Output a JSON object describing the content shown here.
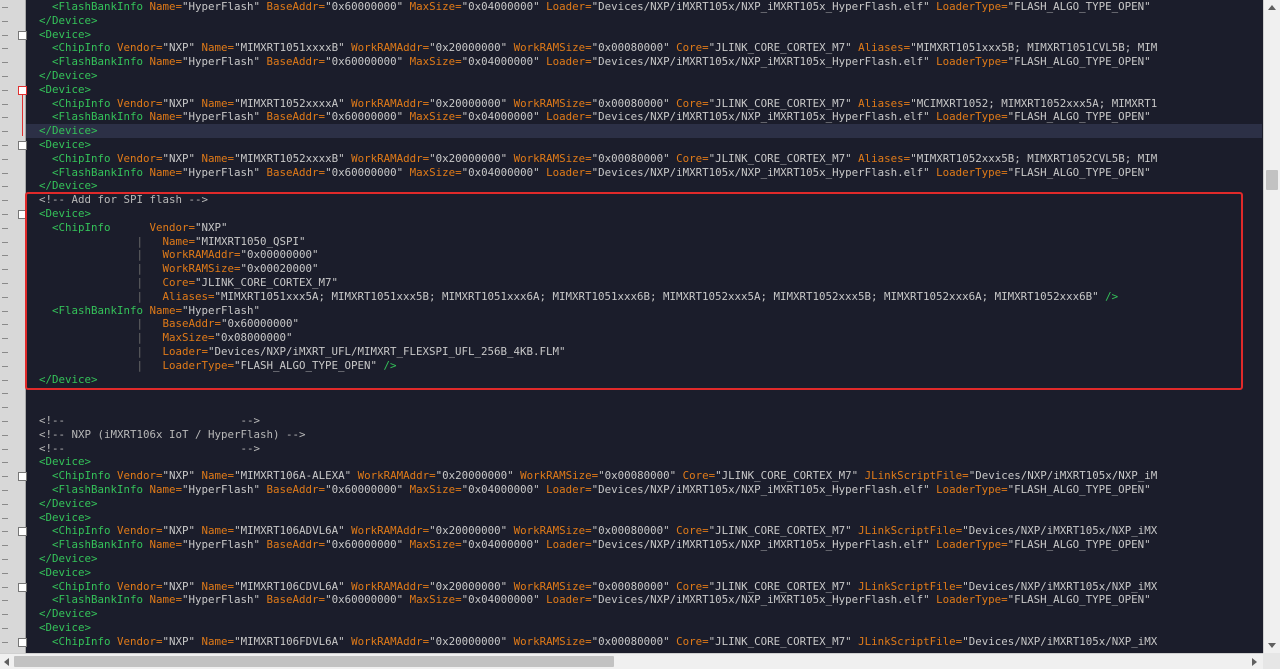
{
  "editor": {
    "lines": [
      [
        [
          "gd",
          ""
        ],
        [
          "tg",
          "    <FlashBankInfo "
        ],
        [
          "at",
          "Name="
        ],
        [
          "vl",
          "\"HyperFlash\" "
        ],
        [
          "at",
          "BaseAddr="
        ],
        [
          "vl",
          "\"0x60000000\" "
        ],
        [
          "at",
          "MaxSize="
        ],
        [
          "vl",
          "\"0x04000000\" "
        ],
        [
          "at",
          "Loader="
        ],
        [
          "vl",
          "\"Devices/NXP/iMXRT105x/NXP_iMXRT105x_HyperFlash.elf\" "
        ],
        [
          "at",
          "LoaderType="
        ],
        [
          "vl",
          "\"FLASH_ALGO_TYPE_OPEN\""
        ]
      ],
      [
        [
          "tg",
          "  </Device>"
        ]
      ],
      [
        [
          "tg",
          "  <Device>"
        ]
      ],
      [
        [
          "tg",
          "    <ChipInfo "
        ],
        [
          "at",
          "Vendor="
        ],
        [
          "vl",
          "\"NXP\" "
        ],
        [
          "at",
          "Name="
        ],
        [
          "vl",
          "\"MIMXRT1051xxxxB\" "
        ],
        [
          "at",
          "WorkRAMAddr="
        ],
        [
          "vl",
          "\"0x20000000\" "
        ],
        [
          "at",
          "WorkRAMSize="
        ],
        [
          "vl",
          "\"0x00080000\" "
        ],
        [
          "at",
          "Core="
        ],
        [
          "vl",
          "\"JLINK_CORE_CORTEX_M7\" "
        ],
        [
          "at",
          "Aliases="
        ],
        [
          "vl",
          "\"MIMXRT1051xxx5B; MIMXRT1051CVL5B; MIM"
        ]
      ],
      [
        [
          "tg",
          "    <FlashBankInfo "
        ],
        [
          "at",
          "Name="
        ],
        [
          "vl",
          "\"HyperFlash\" "
        ],
        [
          "at",
          "BaseAddr="
        ],
        [
          "vl",
          "\"0x60000000\" "
        ],
        [
          "at",
          "MaxSize="
        ],
        [
          "vl",
          "\"0x04000000\" "
        ],
        [
          "at",
          "Loader="
        ],
        [
          "vl",
          "\"Devices/NXP/iMXRT105x/NXP_iMXRT105x_HyperFlash.elf\" "
        ],
        [
          "at",
          "LoaderType="
        ],
        [
          "vl",
          "\"FLASH_ALGO_TYPE_OPEN\""
        ]
      ],
      [
        [
          "tg",
          "  </Device>"
        ]
      ],
      [
        [
          "tg",
          "  <Device>"
        ]
      ],
      [
        [
          "tg",
          "    <ChipInfo "
        ],
        [
          "at",
          "Vendor="
        ],
        [
          "vl",
          "\"NXP\" "
        ],
        [
          "at",
          "Name="
        ],
        [
          "vl",
          "\"MIMXRT1052xxxxA\" "
        ],
        [
          "at",
          "WorkRAMAddr="
        ],
        [
          "vl",
          "\"0x20000000\" "
        ],
        [
          "at",
          "WorkRAMSize="
        ],
        [
          "vl",
          "\"0x00080000\" "
        ],
        [
          "at",
          "Core="
        ],
        [
          "vl",
          "\"JLINK_CORE_CORTEX_M7\" "
        ],
        [
          "at",
          "Aliases="
        ],
        [
          "vl",
          "\"MCIMXRT1052; MIMXRT1052xxx5A; MIMXRT1"
        ]
      ],
      [
        [
          "tg",
          "    <FlashBankInfo "
        ],
        [
          "at",
          "Name="
        ],
        [
          "vl",
          "\"HyperFlash\" "
        ],
        [
          "at",
          "BaseAddr="
        ],
        [
          "vl",
          "\"0x60000000\" "
        ],
        [
          "at",
          "MaxSize="
        ],
        [
          "vl",
          "\"0x04000000\" "
        ],
        [
          "at",
          "Loader="
        ],
        [
          "vl",
          "\"Devices/NXP/iMXRT105x/NXP_iMXRT105x_HyperFlash.elf\" "
        ],
        [
          "at",
          "LoaderType="
        ],
        [
          "vl",
          "\"FLASH_ALGO_TYPE_OPEN\""
        ]
      ],
      [
        [
          "tg",
          "  </Device>"
        ]
      ],
      [
        [
          "tg",
          "  <Device>"
        ]
      ],
      [
        [
          "tg",
          "    <ChipInfo "
        ],
        [
          "at",
          "Vendor="
        ],
        [
          "vl",
          "\"NXP\" "
        ],
        [
          "at",
          "Name="
        ],
        [
          "vl",
          "\"MIMXRT1052xxxxB\" "
        ],
        [
          "at",
          "WorkRAMAddr="
        ],
        [
          "vl",
          "\"0x20000000\" "
        ],
        [
          "at",
          "WorkRAMSize="
        ],
        [
          "vl",
          "\"0x00080000\" "
        ],
        [
          "at",
          "Core="
        ],
        [
          "vl",
          "\"JLINK_CORE_CORTEX_M7\" "
        ],
        [
          "at",
          "Aliases="
        ],
        [
          "vl",
          "\"MIMXRT1052xxx5B; MIMXRT1052CVL5B; MIM"
        ]
      ],
      [
        [
          "tg",
          "    <FlashBankInfo "
        ],
        [
          "at",
          "Name="
        ],
        [
          "vl",
          "\"HyperFlash\" "
        ],
        [
          "at",
          "BaseAddr="
        ],
        [
          "vl",
          "\"0x60000000\" "
        ],
        [
          "at",
          "MaxSize="
        ],
        [
          "vl",
          "\"0x04000000\" "
        ],
        [
          "at",
          "Loader="
        ],
        [
          "vl",
          "\"Devices/NXP/iMXRT105x/NXP_iMXRT105x_HyperFlash.elf\" "
        ],
        [
          "at",
          "LoaderType="
        ],
        [
          "vl",
          "\"FLASH_ALGO_TYPE_OPEN\""
        ]
      ],
      [
        [
          "tg",
          "  </Device>"
        ]
      ],
      [
        [
          "cm",
          "  <!-- Add for SPI flash -->"
        ]
      ],
      [
        [
          "tg",
          "  <Device>"
        ]
      ],
      [
        [
          "tg",
          "    <ChipInfo      "
        ],
        [
          "at",
          "Vendor="
        ],
        [
          "vl",
          "\"NXP\""
        ]
      ],
      [
        [
          "gd",
          "                 |   "
        ],
        [
          "at",
          "Name="
        ],
        [
          "vl",
          "\"MIMXRT1050_QSPI\""
        ]
      ],
      [
        [
          "gd",
          "                 |   "
        ],
        [
          "at",
          "WorkRAMAddr="
        ],
        [
          "vl",
          "\"0x00000000\""
        ]
      ],
      [
        [
          "gd",
          "                 |   "
        ],
        [
          "at",
          "WorkRAMSize="
        ],
        [
          "vl",
          "\"0x00020000\""
        ]
      ],
      [
        [
          "gd",
          "                 |   "
        ],
        [
          "at",
          "Core="
        ],
        [
          "vl",
          "\"JLINK_CORE_CORTEX_M7\""
        ]
      ],
      [
        [
          "gd",
          "                 |   "
        ],
        [
          "at",
          "Aliases="
        ],
        [
          "vl",
          "\"MIMXRT1051xxx5A; MIMXRT1051xxx5B; MIMXRT1051xxx6A; MIMXRT1051xxx6B; MIMXRT1052xxx5A; MIMXRT1052xxx5B; MIMXRT1052xxx6A; MIMXRT1052xxx6B\" "
        ],
        [
          "tg",
          "/>"
        ]
      ],
      [
        [
          "tg",
          "    <FlashBankInfo "
        ],
        [
          "at",
          "Name="
        ],
        [
          "vl",
          "\"HyperFlash\""
        ]
      ],
      [
        [
          "gd",
          "                 |   "
        ],
        [
          "at",
          "BaseAddr="
        ],
        [
          "vl",
          "\"0x60000000\""
        ]
      ],
      [
        [
          "gd",
          "                 |   "
        ],
        [
          "at",
          "MaxSize="
        ],
        [
          "vl",
          "\"0x08000000\""
        ]
      ],
      [
        [
          "gd",
          "                 |   "
        ],
        [
          "at",
          "Loader="
        ],
        [
          "vl",
          "\"Devices/NXP/iMXRT_UFL/MIMXRT_FLEXSPI_UFL_256B_4KB.FLM\""
        ]
      ],
      [
        [
          "gd",
          "                 |   "
        ],
        [
          "at",
          "LoaderType="
        ],
        [
          "vl",
          "\"FLASH_ALGO_TYPE_OPEN\" "
        ],
        [
          "tg",
          "/>"
        ]
      ],
      [
        [
          "tg",
          "  </Device>"
        ]
      ],
      [
        [
          "vl",
          ""
        ]
      ],
      [
        [
          "vl",
          ""
        ]
      ],
      [
        [
          "cm",
          "  <!--                           -->"
        ]
      ],
      [
        [
          "cm",
          "  <!-- NXP (iMXRT106x IoT / HyperFlash) -->"
        ]
      ],
      [
        [
          "cm",
          "  <!--                           -->"
        ]
      ],
      [
        [
          "tg",
          "  <Device>"
        ]
      ],
      [
        [
          "tg",
          "    <ChipInfo "
        ],
        [
          "at",
          "Vendor="
        ],
        [
          "vl",
          "\"NXP\" "
        ],
        [
          "at",
          "Name="
        ],
        [
          "vl",
          "\"MIMXRT106A-ALEXA\" "
        ],
        [
          "at",
          "WorkRAMAddr="
        ],
        [
          "vl",
          "\"0x20000000\" "
        ],
        [
          "at",
          "WorkRAMSize="
        ],
        [
          "vl",
          "\"0x00080000\" "
        ],
        [
          "at",
          "Core="
        ],
        [
          "vl",
          "\"JLINK_CORE_CORTEX_M7\" "
        ],
        [
          "at",
          "JLinkScriptFile="
        ],
        [
          "vl",
          "\"Devices/NXP/iMXRT105x/NXP_iM"
        ]
      ],
      [
        [
          "tg",
          "    <FlashBankInfo "
        ],
        [
          "at",
          "Name="
        ],
        [
          "vl",
          "\"HyperFlash\" "
        ],
        [
          "at",
          "BaseAddr="
        ],
        [
          "vl",
          "\"0x60000000\" "
        ],
        [
          "at",
          "MaxSize="
        ],
        [
          "vl",
          "\"0x04000000\" "
        ],
        [
          "at",
          "Loader="
        ],
        [
          "vl",
          "\"Devices/NXP/iMXRT105x/NXP_iMXRT105x_HyperFlash.elf\" "
        ],
        [
          "at",
          "LoaderType="
        ],
        [
          "vl",
          "\"FLASH_ALGO_TYPE_OPEN\""
        ]
      ],
      [
        [
          "tg",
          "  </Device>"
        ]
      ],
      [
        [
          "tg",
          "  <Device>"
        ]
      ],
      [
        [
          "tg",
          "    <ChipInfo "
        ],
        [
          "at",
          "Vendor="
        ],
        [
          "vl",
          "\"NXP\" "
        ],
        [
          "at",
          "Name="
        ],
        [
          "vl",
          "\"MIMXRT106ADVL6A\" "
        ],
        [
          "at",
          "WorkRAMAddr="
        ],
        [
          "vl",
          "\"0x20000000\" "
        ],
        [
          "at",
          "WorkRAMSize="
        ],
        [
          "vl",
          "\"0x00080000\" "
        ],
        [
          "at",
          "Core="
        ],
        [
          "vl",
          "\"JLINK_CORE_CORTEX_M7\" "
        ],
        [
          "at",
          "JLinkScriptFile="
        ],
        [
          "vl",
          "\"Devices/NXP/iMXRT105x/NXP_iMX"
        ]
      ],
      [
        [
          "tg",
          "    <FlashBankInfo "
        ],
        [
          "at",
          "Name="
        ],
        [
          "vl",
          "\"HyperFlash\" "
        ],
        [
          "at",
          "BaseAddr="
        ],
        [
          "vl",
          "\"0x60000000\" "
        ],
        [
          "at",
          "MaxSize="
        ],
        [
          "vl",
          "\"0x04000000\" "
        ],
        [
          "at",
          "Loader="
        ],
        [
          "vl",
          "\"Devices/NXP/iMXRT105x/NXP_iMXRT105x_HyperFlash.elf\" "
        ],
        [
          "at",
          "LoaderType="
        ],
        [
          "vl",
          "\"FLASH_ALGO_TYPE_OPEN\""
        ]
      ],
      [
        [
          "tg",
          "  </Device>"
        ]
      ],
      [
        [
          "tg",
          "  <Device>"
        ]
      ],
      [
        [
          "tg",
          "    <ChipInfo "
        ],
        [
          "at",
          "Vendor="
        ],
        [
          "vl",
          "\"NXP\" "
        ],
        [
          "at",
          "Name="
        ],
        [
          "vl",
          "\"MIMXRT106CDVL6A\" "
        ],
        [
          "at",
          "WorkRAMAddr="
        ],
        [
          "vl",
          "\"0x20000000\" "
        ],
        [
          "at",
          "WorkRAMSize="
        ],
        [
          "vl",
          "\"0x00080000\" "
        ],
        [
          "at",
          "Core="
        ],
        [
          "vl",
          "\"JLINK_CORE_CORTEX_M7\" "
        ],
        [
          "at",
          "JLinkScriptFile="
        ],
        [
          "vl",
          "\"Devices/NXP/iMXRT105x/NXP_iMX"
        ]
      ],
      [
        [
          "tg",
          "    <FlashBankInfo "
        ],
        [
          "at",
          "Name="
        ],
        [
          "vl",
          "\"HyperFlash\" "
        ],
        [
          "at",
          "BaseAddr="
        ],
        [
          "vl",
          "\"0x60000000\" "
        ],
        [
          "at",
          "MaxSize="
        ],
        [
          "vl",
          "\"0x04000000\" "
        ],
        [
          "at",
          "Loader="
        ],
        [
          "vl",
          "\"Devices/NXP/iMXRT105x/NXP_iMXRT105x_HyperFlash.elf\" "
        ],
        [
          "at",
          "LoaderType="
        ],
        [
          "vl",
          "\"FLASH_ALGO_TYPE_OPEN\""
        ]
      ],
      [
        [
          "tg",
          "  </Device>"
        ]
      ],
      [
        [
          "tg",
          "  <Device>"
        ]
      ],
      [
        [
          "tg",
          "    <ChipInfo "
        ],
        [
          "at",
          "Vendor="
        ],
        [
          "vl",
          "\"NXP\" "
        ],
        [
          "at",
          "Name="
        ],
        [
          "vl",
          "\"MIMXRT106FDVL6A\" "
        ],
        [
          "at",
          "WorkRAMAddr="
        ],
        [
          "vl",
          "\"0x20000000\" "
        ],
        [
          "at",
          "WorkRAMSize="
        ],
        [
          "vl",
          "\"0x00080000\" "
        ],
        [
          "at",
          "Core="
        ],
        [
          "vl",
          "\"JLINK_CORE_CORTEX_M7\" "
        ],
        [
          "at",
          "JLinkScriptFile="
        ],
        [
          "vl",
          "\"Devices/NXP/iMXRT105x/NXP_iMX"
        ]
      ]
    ],
    "highlighted_line": 9,
    "fold_markers": [
      2,
      6,
      10,
      15,
      34,
      38,
      42,
      46
    ],
    "fold_markers_red": [
      6
    ]
  },
  "colors": {
    "background": "#1b1d2b",
    "tag": "#34c259",
    "attribute": "#e07a18",
    "value": "#c8c8c8",
    "annotation_box": "#e02a2a"
  }
}
